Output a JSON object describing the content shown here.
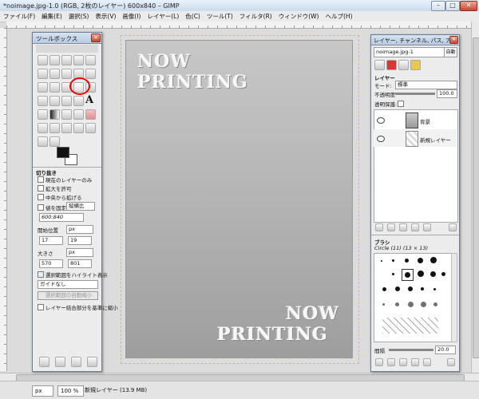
{
  "window": {
    "title": "*noimage.jpg-1.0 (RGB, 2枚のレイヤー) 600x840 – GIMP",
    "min_label": "–",
    "max_label": "□",
    "close_label": "✕"
  },
  "menu": [
    "ファイル(F)",
    "編集(E)",
    "選択(S)",
    "表示(V)",
    "画像(I)",
    "レイヤー(L)",
    "色(C)",
    "ツール(T)",
    "フィルタ(R)",
    "ウィンドウ(W)",
    "ヘルプ(H)"
  ],
  "canvas": {
    "top_text_1": "NOW",
    "top_text_2": "PRINTING",
    "bottom_text_1": "NOW",
    "bottom_text_2": "PRINTING"
  },
  "toolbox": {
    "title": "ツールボックス",
    "section_title": "切り抜き",
    "options": {
      "current_layer_only": "現在のレイヤーのみ",
      "allow_grow": "拡大を許可",
      "expand_from_center": "中央から拡げる",
      "fixed": "値を固定",
      "fixed_mode": "縦横比",
      "ratio": "600:840",
      "position_label": "開始位置",
      "position_unit": "px",
      "position_x": "17",
      "position_y": "19",
      "size_label": "大きさ",
      "size_unit": "px",
      "size_w": "570",
      "size_h": "801",
      "highlight": "選択範囲をハイライト表示",
      "guides": "ガイドなし",
      "auto_shrink": "選択範囲の自動縮小",
      "shrink_merged": "レイヤー結合部分を基準に縮小"
    }
  },
  "dock": {
    "title": "レイヤー, チャンネル, パス, ア...",
    "image_select": "noimage.jpg-1",
    "auto_button": "自動",
    "layers_title": "レイヤー",
    "mode_label": "モード:",
    "mode_value": "標準",
    "opacity_label": "不透明度",
    "opacity_value": "100.0",
    "lock_label": "透明保護:",
    "layers": [
      "背景",
      "新規レイヤー"
    ],
    "brushes_title": "ブラシ",
    "brush_name": "Circle (11) (13 × 13)",
    "spacing_label": "間隔",
    "spacing_value": "20.0"
  },
  "status": {
    "unit": "px",
    "zoom": "100 %",
    "info": "新規レイヤー (13.9 MB)"
  },
  "colors": {
    "annotation_circle": "#e00000",
    "foreground": "#111111",
    "background": "#ffffff"
  }
}
